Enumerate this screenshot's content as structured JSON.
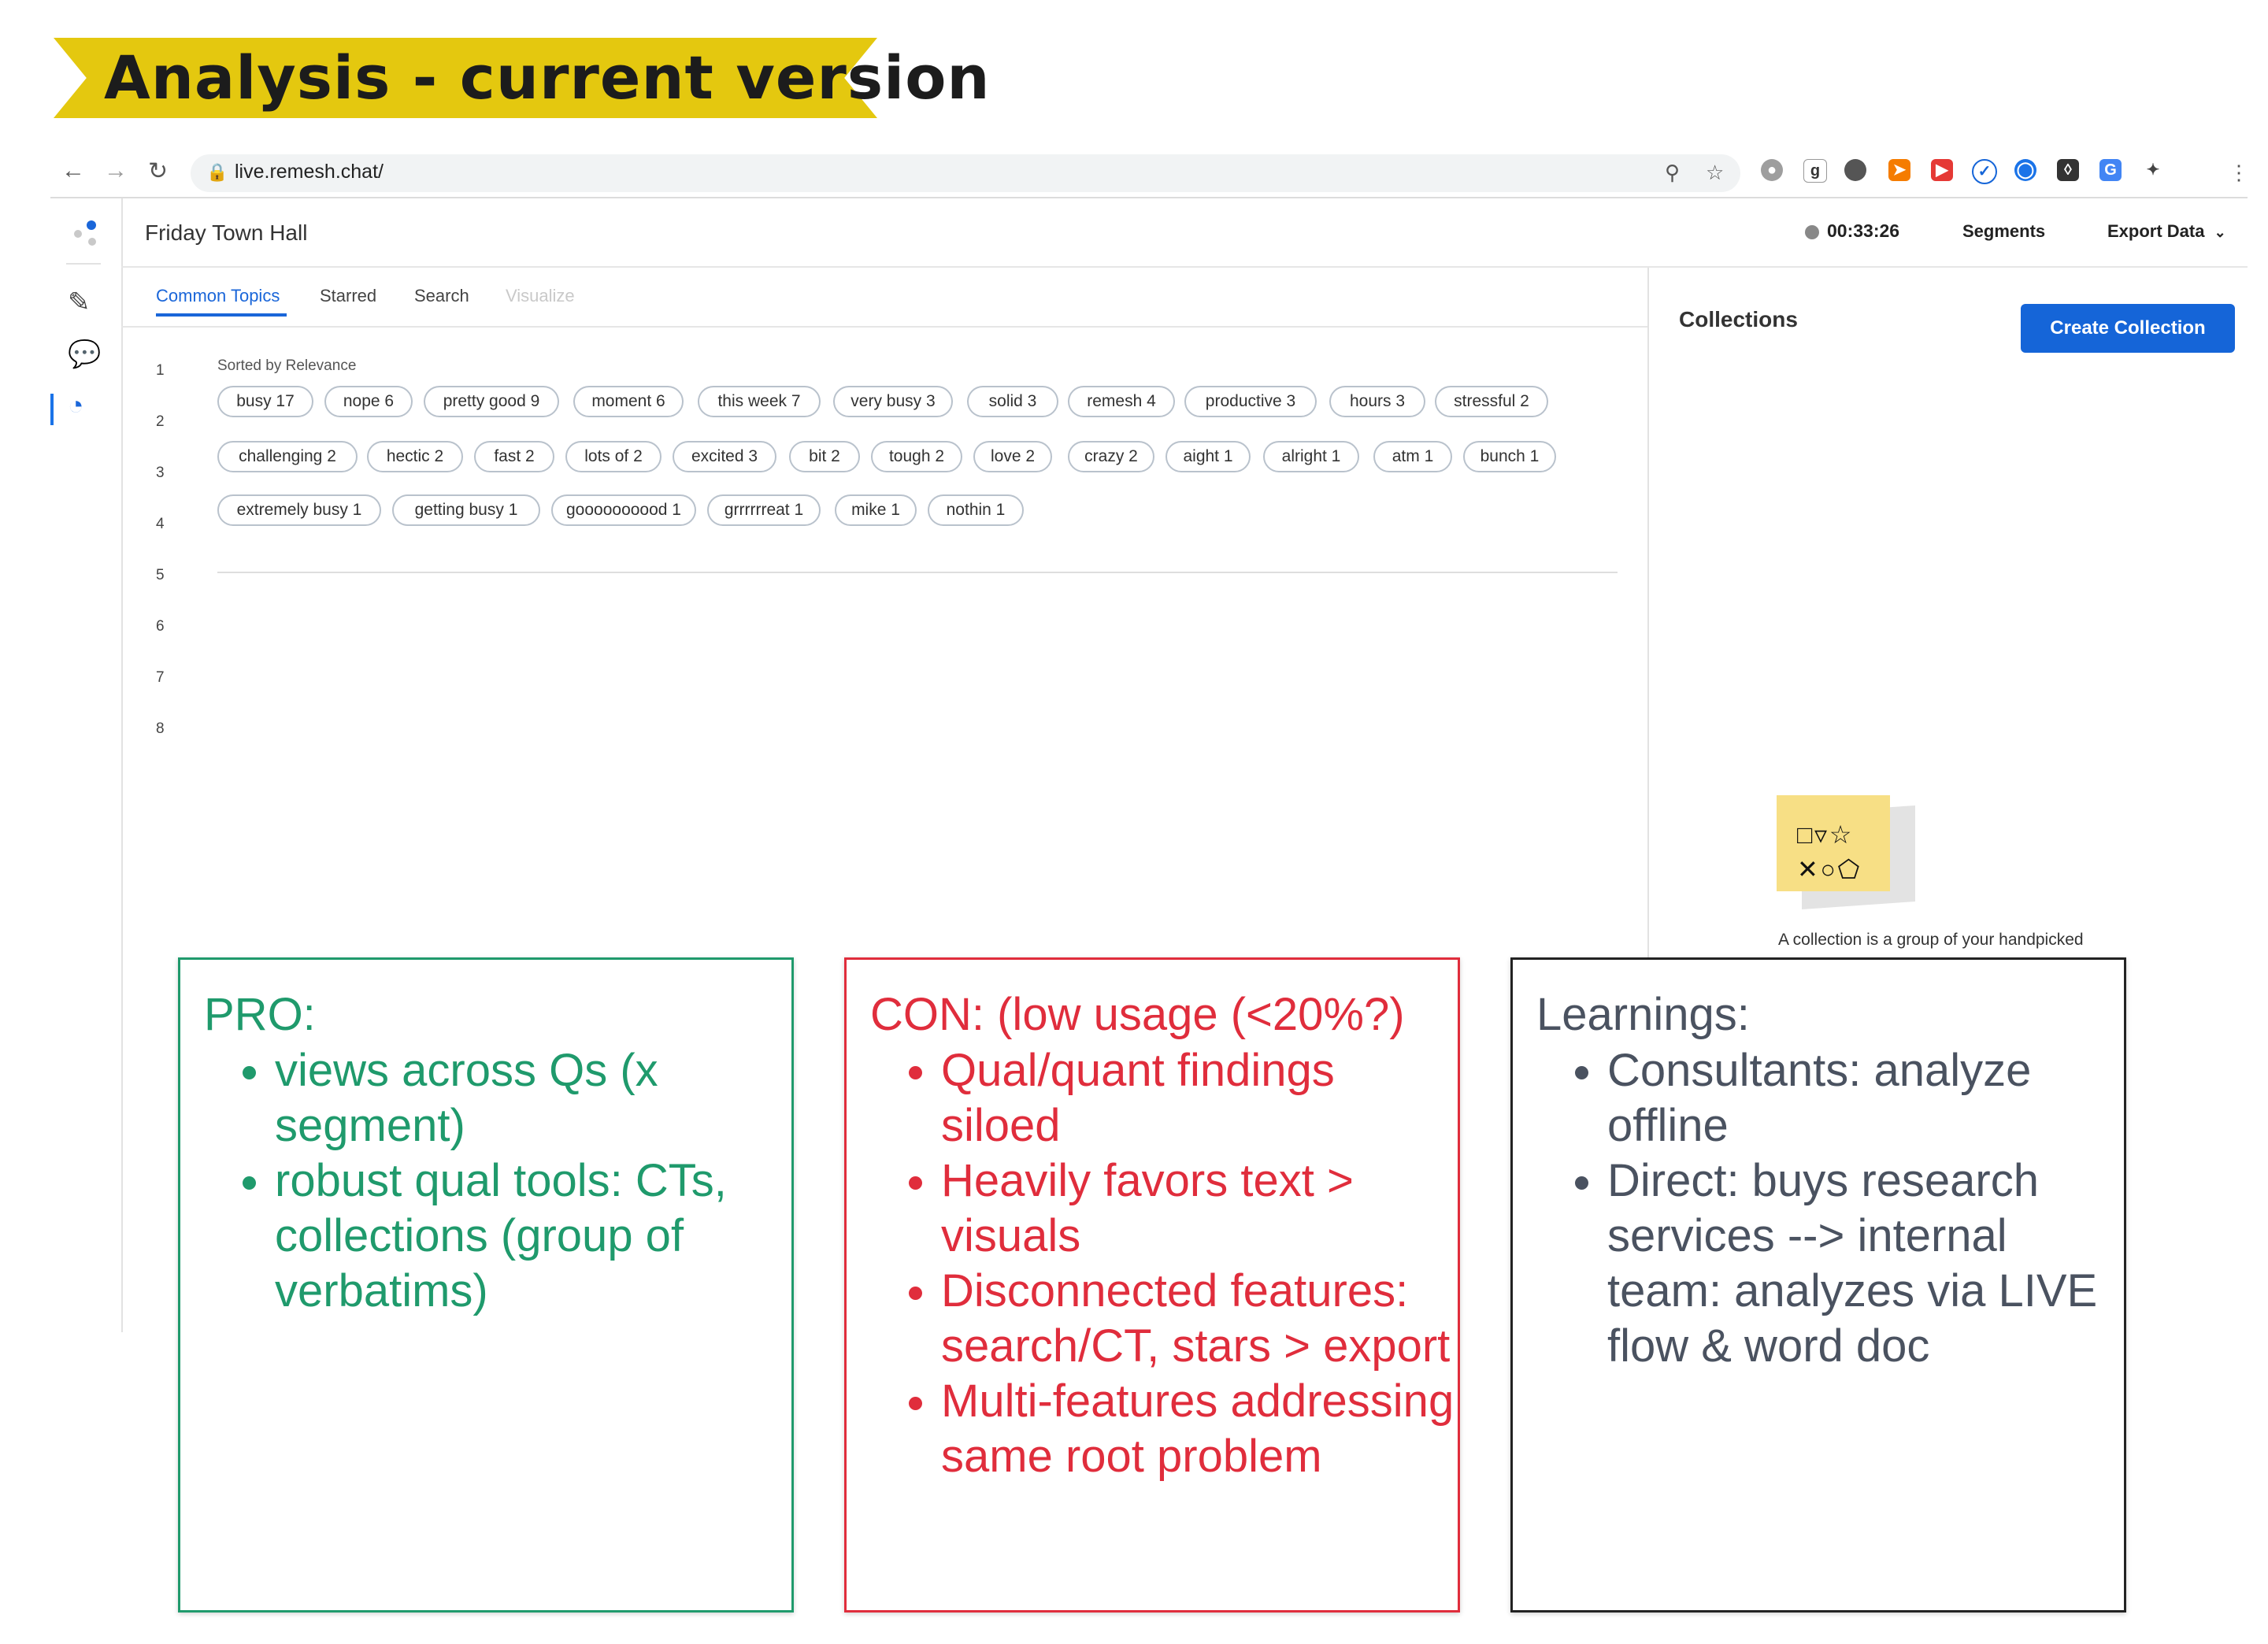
{
  "slide_title": "Analysis - current version",
  "browser": {
    "url": "live.remesh.chat/",
    "icons": [
      "back-arrow-icon",
      "forward-arrow-icon",
      "reload-icon",
      "lock-icon",
      "zoom-icon",
      "star-icon",
      "menu-dots-icon"
    ]
  },
  "app": {
    "title": "Friday Town Hall",
    "timer": "00:33:26",
    "segments_label": "Segments",
    "export_label": "Export Data",
    "tabs": [
      {
        "label": "Common Topics",
        "state": "active"
      },
      {
        "label": "Starred",
        "state": "normal"
      },
      {
        "label": "Search",
        "state": "normal"
      },
      {
        "label": "Visualize",
        "state": "disabled"
      }
    ],
    "row_numbers": [
      "1",
      "2",
      "3",
      "4",
      "5",
      "6",
      "7",
      "8"
    ],
    "sorted_label": "Sorted by Relevance",
    "topic_rows": [
      [
        "busy  17",
        "nope  6",
        "pretty good  9",
        "moment  6",
        "this week  7",
        "very busy  3",
        "solid  3",
        "remesh  4",
        "productive  3",
        "hours  3",
        "stressful  2"
      ],
      [
        "challenging  2",
        "hectic  2",
        "fast  2",
        "lots of  2",
        "excited  3",
        "bit  2",
        "tough  2",
        "love  2",
        "crazy  2",
        "aight  1",
        "alright  1",
        "atm  1",
        "bunch  1"
      ],
      [
        "extremely busy  1",
        "getting busy  1",
        "goooooooood  1",
        "grrrrrreat  1",
        "mike  1",
        "nothin  1"
      ]
    ],
    "collections_title": "Collections",
    "create_collection_label": "Create Collection",
    "collection_caption": "A collection is a group of your handpicked",
    "accent_color": "#1565d8"
  },
  "notes": {
    "pro": {
      "heading": "PRO:",
      "items": [
        "views across Qs (x segment)",
        "robust qual tools: CTs, collections (group of verbatims)"
      ],
      "color": "#1f9a6c"
    },
    "con": {
      "heading": "CON: (low usage (<20%?)",
      "items": [
        "Qual/quant findings siloed",
        "Heavily favors text > visuals",
        "Disconnected features: search/CT, stars > export",
        "Multi-features addressing same root problem"
      ],
      "color": "#e02d3c"
    },
    "learnings": {
      "heading": "Learnings:",
      "items": [
        "Consultants: analyze offline",
        "Direct: buys research services --> internal team: analyzes via LIVE flow & word doc"
      ],
      "color": "#4a5260"
    }
  }
}
